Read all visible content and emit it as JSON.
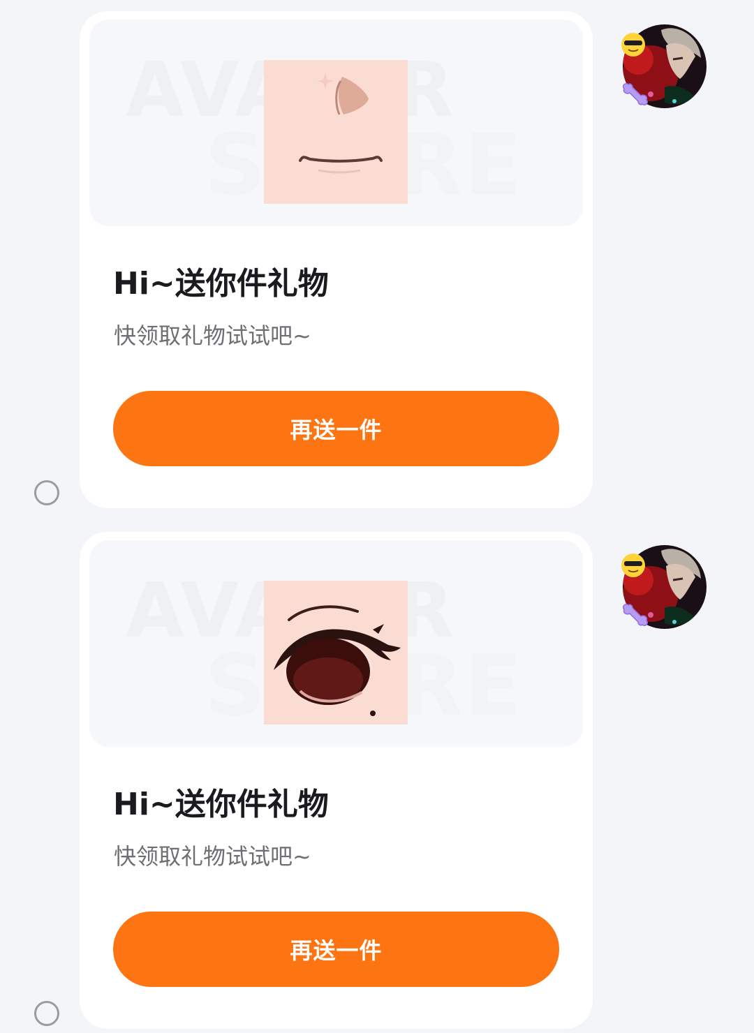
{
  "watermark": {
    "line1": "AVATAR",
    "line2": "STORE"
  },
  "messages": [
    {
      "item_icon": "face-mouth-nose-icon",
      "title": "Hi~送你件礼物",
      "subtitle": "快领取礼物试试吧~",
      "button_label": "再送一件"
    },
    {
      "item_icon": "anime-eye-icon",
      "title": "Hi~送你件礼物",
      "subtitle": "快领取礼物试试吧~",
      "button_label": "再送一件"
    }
  ],
  "colors": {
    "accent": "#fd7412",
    "background": "#f3f5f9",
    "card": "#ffffff",
    "item_tile": "#fadcd2"
  }
}
